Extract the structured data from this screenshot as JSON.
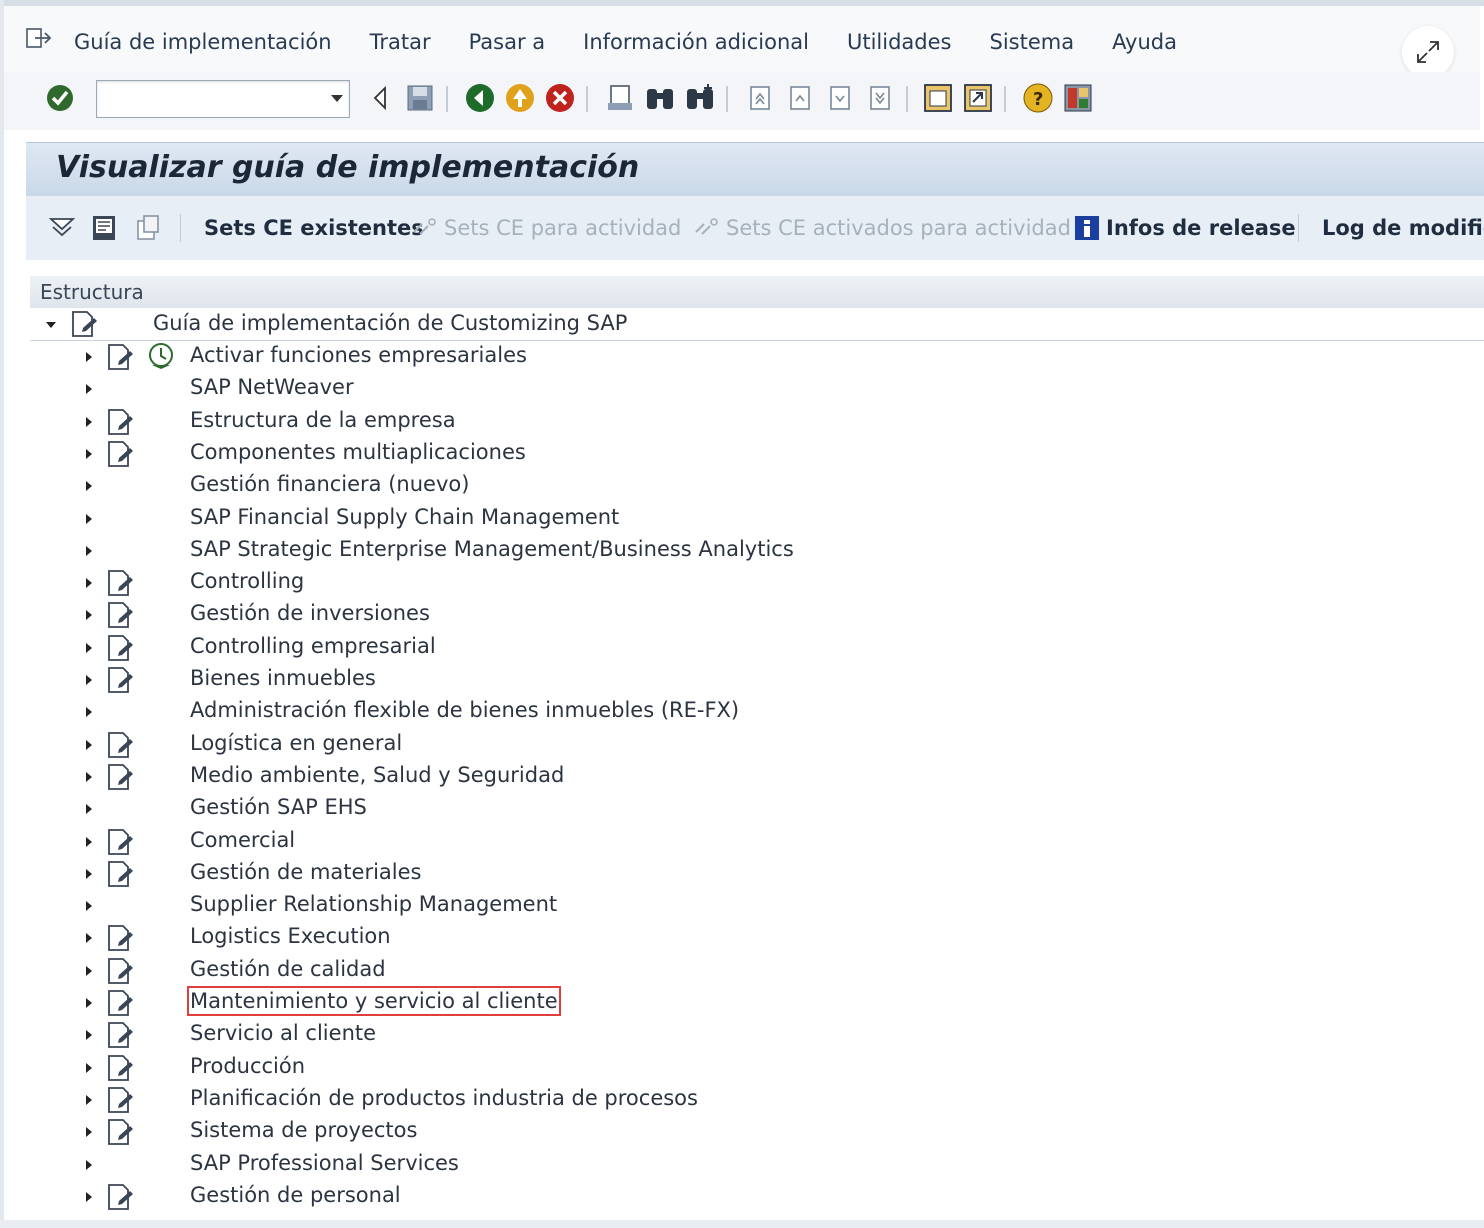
{
  "menu": {
    "items": [
      {
        "label": "Guía de implementación"
      },
      {
        "label": "Tratar"
      },
      {
        "label": "Pasar a"
      },
      {
        "label": "Información adicional"
      },
      {
        "label": "Utilidades"
      },
      {
        "label": "Sistema"
      },
      {
        "label": "Ayuda"
      }
    ]
  },
  "toolbar": {
    "command_field_value": ""
  },
  "page": {
    "title": "Visualizar guía de implementación"
  },
  "app_toolbar": {
    "sets_ce_existentes": "Sets CE existentes",
    "sets_ce_para_actividad": "Sets CE para actividad",
    "sets_ce_activados": "Sets CE activados para actividad",
    "infos_release": "Infos de release",
    "log_modificaciones": "Log de modifica"
  },
  "tree": {
    "header": "Estructura",
    "root": "Guía de implementación de Customizing SAP",
    "items": [
      {
        "label": "Activar funciones empresariales",
        "doc_icon": true,
        "activation_icon": true
      },
      {
        "label": "SAP NetWeaver",
        "doc_icon": false
      },
      {
        "label": "Estructura de la empresa",
        "doc_icon": true
      },
      {
        "label": "Componentes multiaplicaciones",
        "doc_icon": true
      },
      {
        "label": "Gestión financiera (nuevo)",
        "doc_icon": false
      },
      {
        "label": "SAP Financial Supply Chain Management",
        "doc_icon": false
      },
      {
        "label": "SAP Strategic Enterprise Management/Business Analytics",
        "doc_icon": false
      },
      {
        "label": "Controlling",
        "doc_icon": true
      },
      {
        "label": "Gestión de inversiones",
        "doc_icon": true
      },
      {
        "label": "Controlling empresarial",
        "doc_icon": true
      },
      {
        "label": "Bienes inmuebles",
        "doc_icon": true
      },
      {
        "label": "Administración flexible de bienes inmuebles (RE-FX)",
        "doc_icon": false
      },
      {
        "label": "Logística en general",
        "doc_icon": true
      },
      {
        "label": "Medio ambiente, Salud y Seguridad",
        "doc_icon": true
      },
      {
        "label": "Gestión SAP EHS",
        "doc_icon": false
      },
      {
        "label": "Comercial",
        "doc_icon": true
      },
      {
        "label": "Gestión de materiales",
        "doc_icon": true
      },
      {
        "label": "Supplier Relationship Management",
        "doc_icon": false
      },
      {
        "label": "Logistics Execution",
        "doc_icon": true
      },
      {
        "label": "Gestión de calidad",
        "doc_icon": true
      },
      {
        "label": "Mantenimiento y servicio al cliente",
        "doc_icon": true,
        "selected": true
      },
      {
        "label": "Servicio al cliente",
        "doc_icon": true
      },
      {
        "label": "Producción",
        "doc_icon": true
      },
      {
        "label": "Planificación de productos industria de procesos",
        "doc_icon": true
      },
      {
        "label": "Sistema de proyectos",
        "doc_icon": true
      },
      {
        "label": "SAP Professional Services",
        "doc_icon": false
      },
      {
        "label": "Gestión de personal",
        "doc_icon": true
      }
    ]
  },
  "colors": {
    "accent_title_bg": "#c9d8e8",
    "selection_outline": "#e0403c"
  }
}
